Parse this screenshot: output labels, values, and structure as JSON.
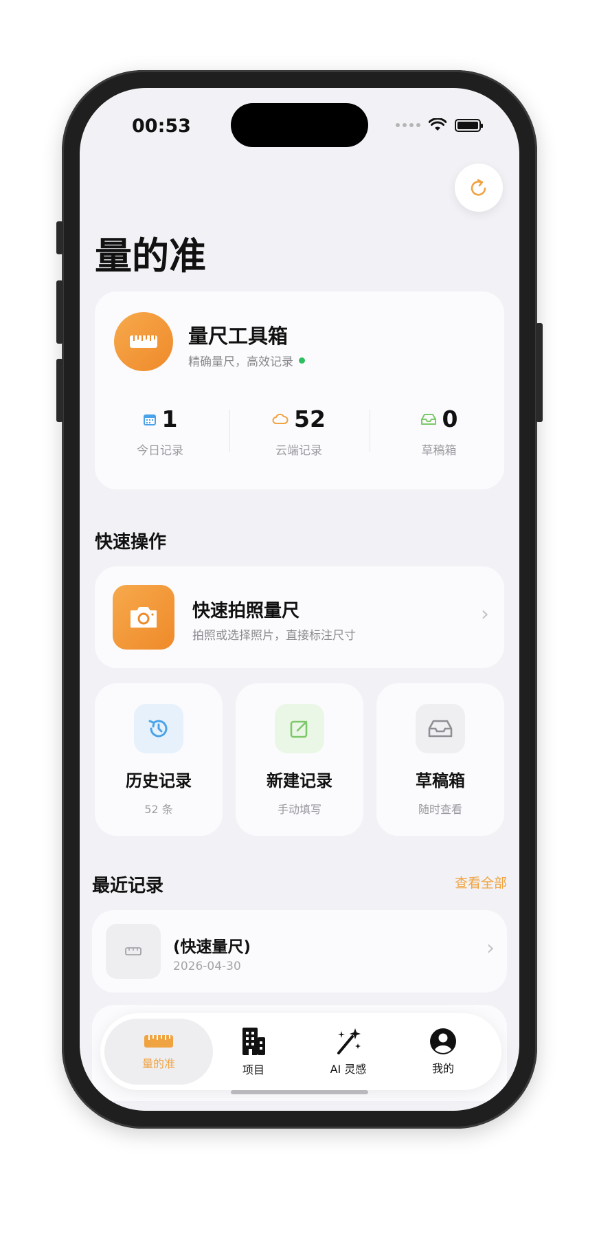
{
  "status": {
    "time": "00:53"
  },
  "app": {
    "title": "量的准"
  },
  "summary": {
    "title": "量尺工具箱",
    "subtitle": "精确量尺，高效记录",
    "stats": [
      {
        "value": "1",
        "label": "今日记录",
        "icon": "calendar-icon",
        "color": "#4aa3e8"
      },
      {
        "value": "52",
        "label": "云端记录",
        "icon": "cloud-icon",
        "color": "#f0a341"
      },
      {
        "value": "0",
        "label": "草稿箱",
        "icon": "inbox-icon",
        "color": "#7dc86a"
      }
    ]
  },
  "quick": {
    "section_title": "快速操作",
    "main_action": {
      "title": "快速拍照量尺",
      "subtitle": "拍照或选择照片，直接标注尺寸"
    },
    "tiles": [
      {
        "title": "历史记录",
        "subtitle": "52 条",
        "icon": "history-icon",
        "color": "#4aa3e8",
        "bg": "#e6f1fc"
      },
      {
        "title": "新建记录",
        "subtitle": "手动填写",
        "icon": "edit-icon",
        "color": "#7dc86a",
        "bg": "#ebf7e6"
      },
      {
        "title": "草稿箱",
        "subtitle": "随时查看",
        "icon": "inbox-icon",
        "color": "#8e8e93",
        "bg": "#efeff2"
      }
    ]
  },
  "recent": {
    "section_title": "最近记录",
    "see_all": "查看全部",
    "items": [
      {
        "title": "(快速量尺)",
        "date": "2026-04-30"
      }
    ]
  },
  "tabbar": {
    "tabs": [
      {
        "label": "量的准",
        "active": true
      },
      {
        "label": "项目",
        "active": false
      },
      {
        "label": "AI 灵感",
        "active": false
      },
      {
        "label": "我的",
        "active": false
      }
    ]
  },
  "colors": {
    "accent": "#f0a341",
    "background": "#f2f2f6"
  }
}
